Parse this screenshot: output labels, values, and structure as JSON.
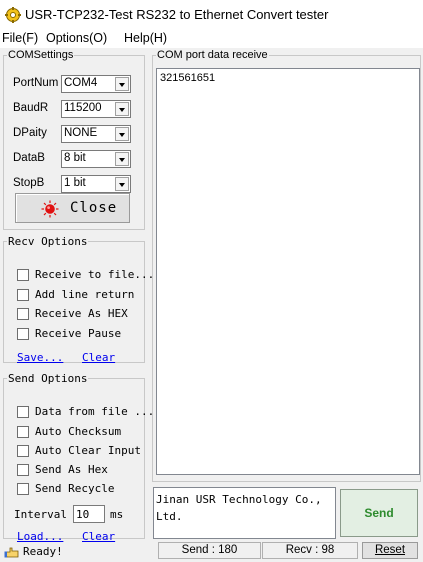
{
  "window": {
    "title": "USR-TCP232-Test  RS232 to Ethernet Convert tester",
    "icon": "usr-app-icon"
  },
  "menu": [
    {
      "label": "File(F)"
    },
    {
      "label": "Options(O)"
    },
    {
      "label": "Help(H)"
    }
  ],
  "com_settings": {
    "legend": "COMSettings",
    "fields": [
      {
        "label": "PortNum",
        "value": "COM4"
      },
      {
        "label": "BaudR",
        "value": "115200"
      },
      {
        "label": "DPaity",
        "value": "NONE"
      },
      {
        "label": "DataB",
        "value": "8 bit"
      },
      {
        "label": "StopB",
        "value": "1 bit"
      }
    ],
    "close_button": "Close",
    "status_led_color": "#e01010"
  },
  "recv_options": {
    "legend": "Recv Options",
    "checks": [
      {
        "label": "Receive to file...",
        "checked": false
      },
      {
        "label": "Add line return",
        "checked": false
      },
      {
        "label": "Receive As HEX",
        "checked": false
      },
      {
        "label": "Receive Pause",
        "checked": false
      }
    ],
    "save_link": "Save...",
    "clear_link": "Clear"
  },
  "send_options": {
    "legend": "Send Options",
    "checks": [
      {
        "label": "Data from file ...",
        "checked": false
      },
      {
        "label": "Auto Checksum",
        "checked": false
      },
      {
        "label": "Auto Clear Input",
        "checked": false
      },
      {
        "label": "Send As Hex",
        "checked": false
      },
      {
        "label": "Send Recycle",
        "checked": false
      }
    ],
    "interval_label": "Interval",
    "interval_value": "10",
    "interval_unit": "ms",
    "load_link": "Load...",
    "clear_link": "Clear"
  },
  "receive_panel": {
    "legend": "COM port data receive",
    "content": "321561651"
  },
  "send_panel": {
    "text": "Jinan USR Technology Co., Ltd.",
    "send_button": "Send",
    "send_color": "#2e8b2e"
  },
  "status_bar": {
    "ready": "Ready!",
    "send_count": "Send : 180",
    "recv_count": "Recv : 98",
    "reset_button": "Reset"
  }
}
